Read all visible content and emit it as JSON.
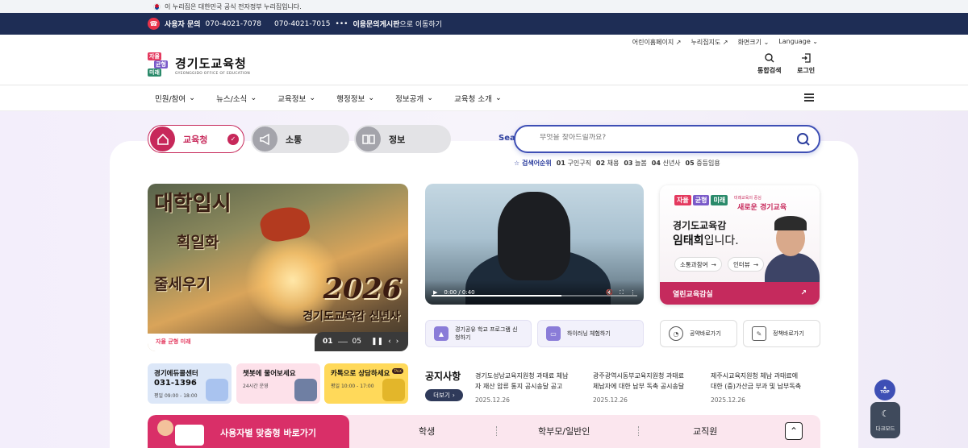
{
  "gov_banner": {
    "text": "이 누리집은 대한민국 공식 전자정부 누리집입니다."
  },
  "inquiry": {
    "label": "사용자 문의",
    "phone1": "070-4021-7078",
    "phone2": "070-4021-7015",
    "board": "이용문의게시판",
    "board_suffix": "으로 이동하기"
  },
  "util": {
    "items": [
      "어린이홈페이지",
      "누리집지도",
      "화면크기",
      "Language"
    ]
  },
  "logo": {
    "tag1": "자율",
    "tag2": "균형",
    "tag3": "미래",
    "name": "경기도교육청",
    "english": "GYEONGGIDO OFFICE OF EDUCATION"
  },
  "header_buttons": {
    "search": "통합검색",
    "login": "로그인"
  },
  "nav": {
    "items": [
      "민원/참여",
      "뉴스/소식",
      "교육정보",
      "행정정보",
      "정보공개",
      "교육청 소개"
    ]
  },
  "tabs": {
    "t1": "교육청",
    "t2": "소통",
    "t3": "정보"
  },
  "search": {
    "label": "Search",
    "placeholder": "무엇을 찾아드릴까요?",
    "rank_title": "검색어순위",
    "ranks": [
      {
        "n": "01",
        "w": "구인구직"
      },
      {
        "n": "02",
        "w": "채용"
      },
      {
        "n": "03",
        "w": "늘봄"
      },
      {
        "n": "04",
        "w": "신년사"
      },
      {
        "n": "05",
        "w": "중등임용"
      }
    ]
  },
  "banner": {
    "t1": "대학입시",
    "t2": "획일화",
    "t3": "줄세우기",
    "year": "2026",
    "subtitle": "경기도교육감 신년사",
    "logo": "자율 균형 미래",
    "current": "01",
    "total": "05"
  },
  "video": {
    "time": "0:00 / 0:40",
    "progress": 0.63
  },
  "superintendent": {
    "tag1": "자율",
    "tag2": "균형",
    "tag3": "미래",
    "slogan_small": "미래교육의 중심",
    "slogan": "새로운 경기교육",
    "title": "경기도교육감",
    "name": "임태희",
    "suffix": "입니다.",
    "pill1": "소통과참여",
    "pill2": "인터뷰",
    "bottom": "열린교육감실"
  },
  "quick": {
    "q1": "경기공유 학교 프로그램 신청하기",
    "q2": "하이러닝 체험하기",
    "q3": "공약바로가기",
    "q4": "정책바로가기"
  },
  "contact": {
    "c1": {
      "title": "경기에듀콜센터",
      "num": "031-1396",
      "sub": "평일 09:00 - 18:00"
    },
    "c2": {
      "title": "챗봇에 물어보세요",
      "sub": "24시간 운영"
    },
    "c3": {
      "title": "카톡으로 상담하세요",
      "sub": "평일 10:00 - 17:00",
      "badge": "TALK"
    }
  },
  "notice": {
    "title": "공지사항",
    "more": "더보기",
    "items": [
      {
        "text": "경기도성남교육지원청 과태료 체납자 재산 압류 통지 공시송달 공고",
        "date": "2025.12.26"
      },
      {
        "text": "광주광역시동부교육지원청 과태료 체납자에 대한 납부 독촉 공시송달 공고",
        "date": "2025.12.26"
      },
      {
        "text": "제주시교육지원청 체납 과태료에 대한 (중)가산금 부과 및 납부독촉 공고",
        "date": "2025.12.26"
      }
    ]
  },
  "audience": {
    "title": "사용자별 맞춤형 바로가기",
    "tabs": [
      "학생",
      "학부모/일반인",
      "교직원"
    ]
  },
  "floating": {
    "top": "TOP",
    "dark": "다크모드"
  }
}
